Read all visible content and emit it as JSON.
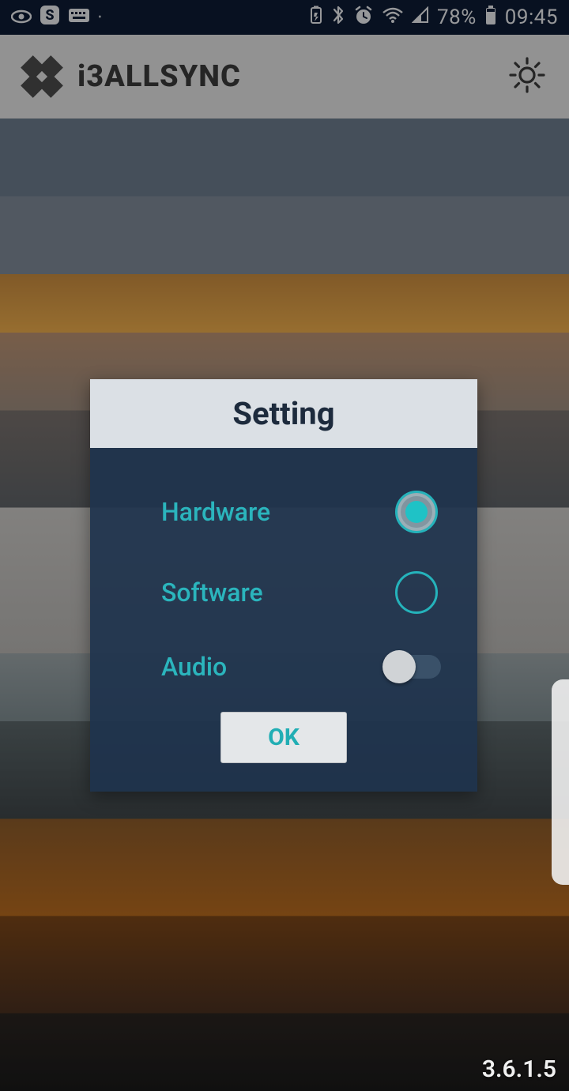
{
  "status": {
    "battery_pct": "78%",
    "time": "09:45"
  },
  "header": {
    "app_name": "i3ALLSYNC"
  },
  "dialog": {
    "title": "Setting",
    "rows": {
      "hardware": {
        "label": "Hardware",
        "selected": true
      },
      "software": {
        "label": "Software",
        "selected": false
      },
      "audio": {
        "label": "Audio",
        "on": false
      }
    },
    "ok_label": "OK"
  },
  "version": "3.6.1.5"
}
